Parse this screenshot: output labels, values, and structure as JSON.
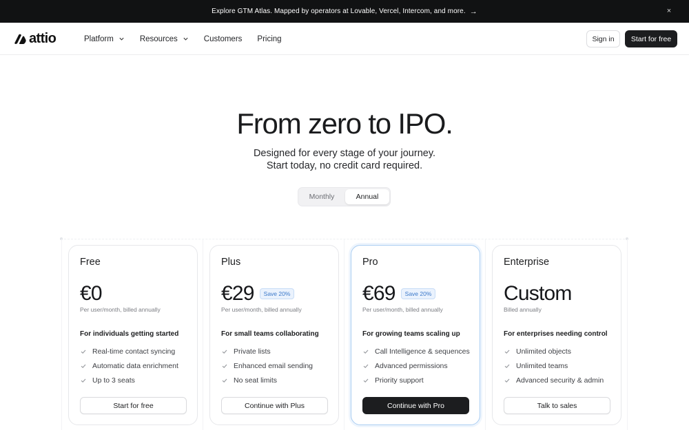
{
  "announcement": {
    "text": "Explore GTM Atlas. Mapped by operators at Lovable, Vercel, Intercom, and more.",
    "arrow": "→",
    "close": "×"
  },
  "nav": {
    "logo": "attio",
    "menu": [
      {
        "label": "Platform",
        "has_dropdown": true
      },
      {
        "label": "Resources",
        "has_dropdown": true
      },
      {
        "label": "Customers",
        "has_dropdown": false
      },
      {
        "label": "Pricing",
        "has_dropdown": false
      }
    ],
    "sign_in": "Sign in",
    "start_free": "Start for free"
  },
  "hero": {
    "title": "From zero to IPO.",
    "subtitle_line1": "Designed for every stage of your journey.",
    "subtitle_line2": "Start today, no credit card required."
  },
  "billing_toggle": {
    "monthly": "Monthly",
    "annual": "Annual",
    "selected": "Annual"
  },
  "plans": [
    {
      "name": "Free",
      "price": "€0",
      "save_badge": "",
      "billing": "Per user/month, billed annually",
      "target": "For individuals getting started",
      "features": [
        "Real-time contact syncing",
        "Automatic data enrichment",
        "Up to 3 seats"
      ],
      "cta": "Start for free"
    },
    {
      "name": "Plus",
      "price": "€29",
      "save_badge": "Save 20%",
      "billing": "Per user/month, billed annually",
      "target": "For small teams collaborating",
      "features": [
        "Private lists",
        "Enhanced email sending",
        "No seat limits"
      ],
      "cta": "Continue with Plus"
    },
    {
      "name": "Pro",
      "price": "€69",
      "save_badge": "Save 20%",
      "billing": "Per user/month, billed annually",
      "target": "For growing teams scaling up",
      "features": [
        "Call Intelligence & sequences",
        "Advanced permissions",
        "Priority support"
      ],
      "cta": "Continue with Pro"
    },
    {
      "name": "Enterprise",
      "price": "Custom",
      "save_badge": "",
      "billing": "Billed annually",
      "target": "For enterprises needing control",
      "features": [
        "Unlimited objects",
        "Unlimited teams",
        "Advanced security & admin"
      ],
      "cta": "Talk to sales"
    }
  ],
  "colors": {
    "announcement_bg": "#111213",
    "primary_button": "#1c1d1f",
    "save_badge_text": "#3a78c9",
    "highlight_border": "#a9cdf2"
  }
}
